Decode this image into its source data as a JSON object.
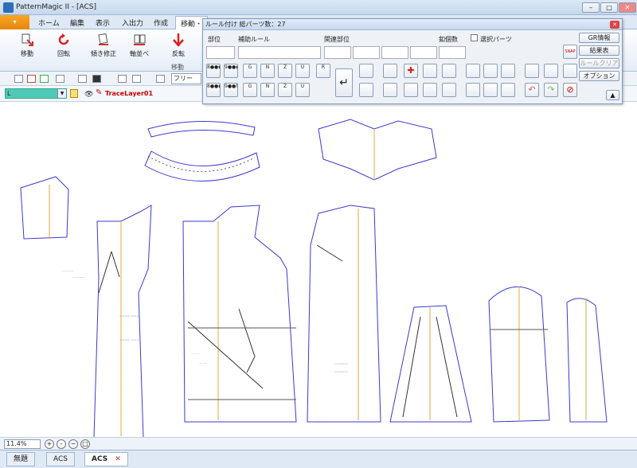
{
  "window": {
    "title": "PatternMagic II - [ACS]",
    "min": "–",
    "max": "□",
    "close": "✕"
  },
  "ribbon_tabs": [
    "ホーム",
    "編集",
    "表示",
    "入出力",
    "作成",
    "移動・"
  ],
  "ribbon_buttons": [
    "移動",
    "回転",
    "傾き修正",
    "軸並べ",
    "反転"
  ],
  "ribbon_group": "移動",
  "quick_toolbar": {
    "mode": "フリー"
  },
  "layer": {
    "select_value": "L",
    "name": "TraceLayer01",
    "accent": "#4fc9b9"
  },
  "palette": {
    "title": "ルール付け 総パーツ数：27",
    "labels": {
      "part": "部位",
      "aux_rule": "補助ルール",
      "related": "関連部位",
      "button_count": "釦個数",
      "selected_parts": "選択パーツ"
    },
    "row1": [
      "8●●●",
      "9●●●",
      "G",
      "N",
      "Z",
      "U",
      "R"
    ],
    "row2": [
      "8●●●",
      "9●●M",
      "G",
      "N",
      "Z",
      "U"
    ],
    "snap_badge": "SNAP",
    "buttons": {
      "gr": "GR情報",
      "result": "結果表",
      "rule_clear": "ルールクリア",
      "option": "オプション",
      "up": "▲"
    }
  },
  "status": {
    "zoom": "11.4%"
  },
  "zoom_buttons": [
    "+",
    "-",
    "−",
    "□"
  ],
  "doc_tabs": [
    "無題",
    "ACS",
    "ACS"
  ],
  "doc_tab_close": "✕"
}
